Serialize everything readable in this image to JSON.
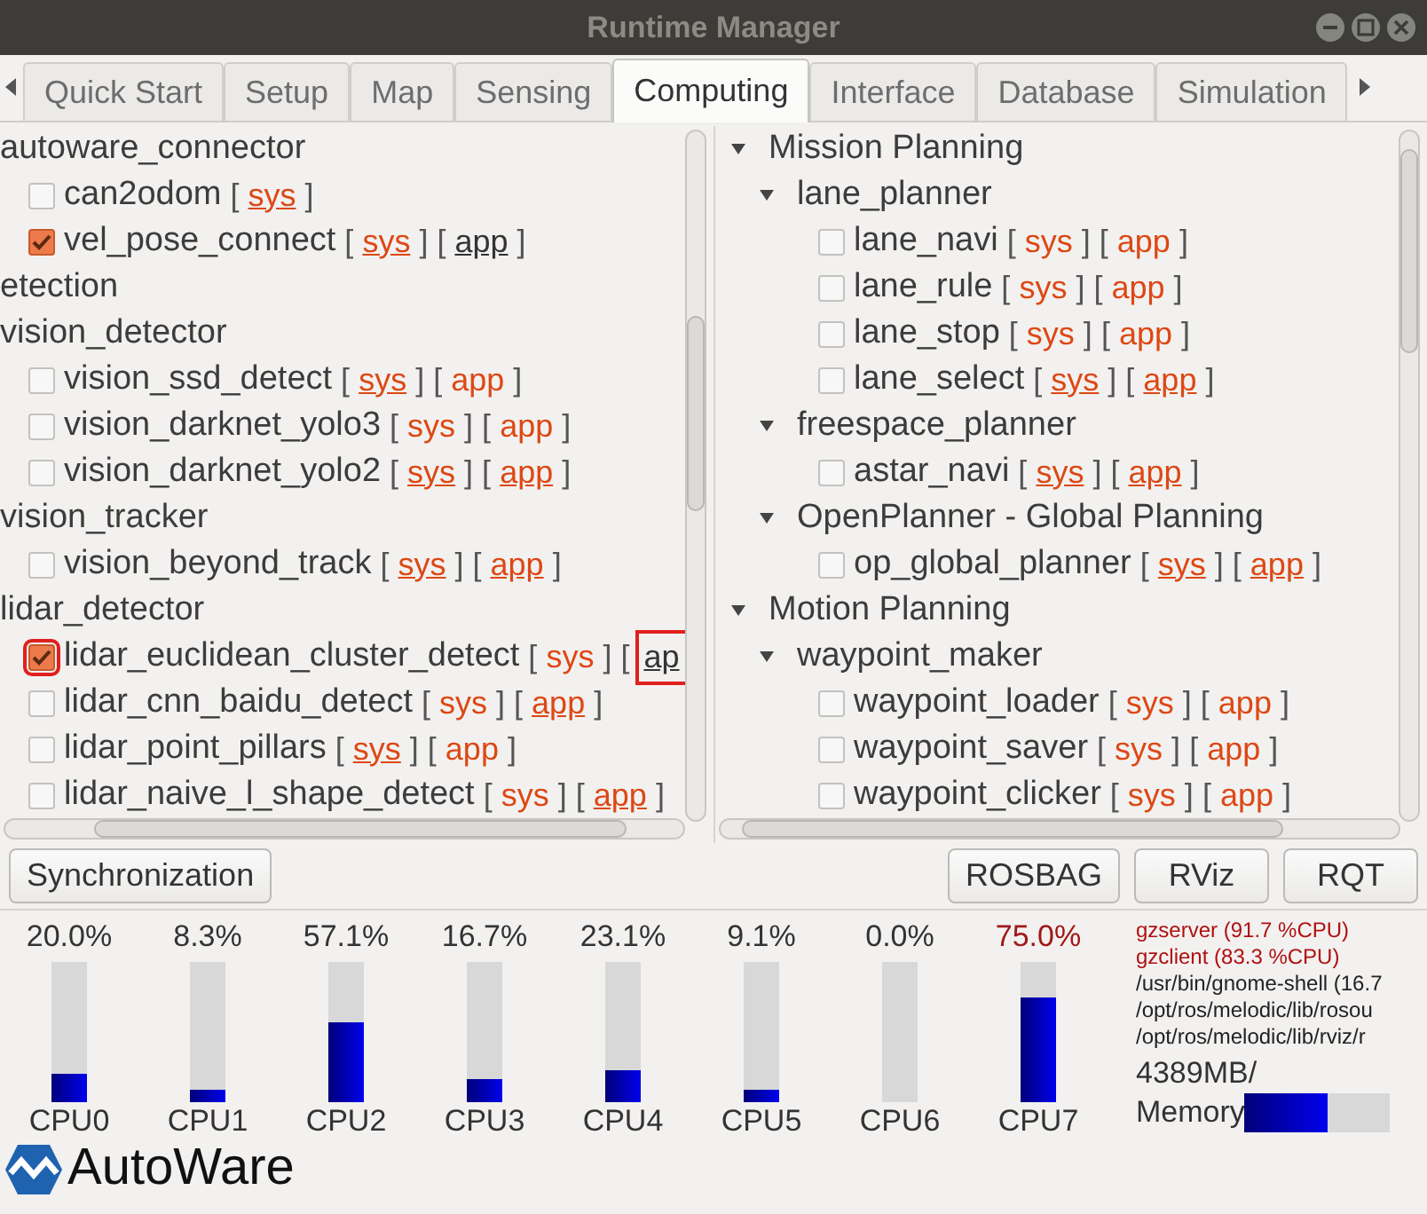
{
  "window": {
    "title": "Runtime Manager"
  },
  "tabs": [
    {
      "label": "Quick Start",
      "selected": false
    },
    {
      "label": "Setup",
      "selected": false
    },
    {
      "label": "Map",
      "selected": false
    },
    {
      "label": "Sensing",
      "selected": false
    },
    {
      "label": "Computing",
      "selected": true
    },
    {
      "label": "Interface",
      "selected": false
    },
    {
      "label": "Database",
      "selected": false
    },
    {
      "label": "Simulation",
      "selected": false
    }
  ],
  "left_tree": [
    {
      "kind": "group",
      "label": "autoware_connector",
      "children": [
        {
          "kind": "check",
          "label": "can2odom",
          "checked": false,
          "links": [
            {
              "label": "sys",
              "underlined": true,
              "visited": false
            }
          ]
        },
        {
          "kind": "check",
          "label": "vel_pose_connect",
          "checked": true,
          "links": [
            {
              "label": "sys",
              "underlined": true,
              "visited": false
            },
            {
              "label": "app",
              "underlined": true,
              "visited": true
            }
          ]
        }
      ]
    },
    {
      "kind": "group",
      "label": "etection"
    },
    {
      "kind": "group",
      "label": "vision_detector",
      "children": [
        {
          "kind": "check",
          "label": "vision_ssd_detect",
          "checked": false,
          "links": [
            {
              "label": "sys",
              "underlined": true,
              "visited": false
            },
            {
              "label": "app",
              "underlined": false,
              "visited": false
            }
          ]
        },
        {
          "kind": "check",
          "label": "vision_darknet_yolo3",
          "checked": false,
          "links": [
            {
              "label": "sys",
              "underlined": false,
              "visited": false
            },
            {
              "label": "app",
              "underlined": false,
              "visited": false
            }
          ]
        },
        {
          "kind": "check",
          "label": "vision_darknet_yolo2",
          "checked": false,
          "links": [
            {
              "label": "sys",
              "underlined": true,
              "visited": false
            },
            {
              "label": "app",
              "underlined": true,
              "visited": false
            }
          ]
        }
      ]
    },
    {
      "kind": "group",
      "label": "vision_tracker",
      "children": [
        {
          "kind": "check",
          "label": "vision_beyond_track",
          "checked": false,
          "links": [
            {
              "label": "sys",
              "underlined": true,
              "visited": false
            },
            {
              "label": "app",
              "underlined": true,
              "visited": false
            }
          ]
        }
      ]
    },
    {
      "kind": "group",
      "label": "lidar_detector",
      "children": [
        {
          "kind": "check",
          "label": "lidar_euclidean_cluster_detect",
          "checked": true,
          "annotated": true,
          "links": [
            {
              "label": "sys",
              "underlined": false,
              "visited": false
            },
            {
              "label": "ap",
              "underlined": true,
              "visited": true,
              "cut": true
            }
          ]
        },
        {
          "kind": "check",
          "label": "lidar_cnn_baidu_detect",
          "checked": false,
          "links": [
            {
              "label": "sys",
              "underlined": false,
              "visited": false
            },
            {
              "label": "app",
              "underlined": true,
              "visited": false
            }
          ]
        },
        {
          "kind": "check",
          "label": "lidar_point_pillars",
          "checked": false,
          "links": [
            {
              "label": "sys",
              "underlined": true,
              "visited": false
            },
            {
              "label": "app",
              "underlined": false,
              "visited": false
            }
          ]
        },
        {
          "kind": "check",
          "label": "lidar_naive_l_shape_detect",
          "checked": false,
          "links": [
            {
              "label": "sys",
              "underlined": false,
              "visited": false
            },
            {
              "label": "app",
              "underlined": true,
              "visited": false
            }
          ]
        }
      ]
    }
  ],
  "right_tree": [
    {
      "kind": "group",
      "label": "Mission Planning",
      "expanded": true,
      "children": [
        {
          "kind": "group",
          "label": "lane_planner",
          "expanded": true,
          "children": [
            {
              "kind": "check",
              "label": "lane_navi",
              "checked": false,
              "links": [
                {
                  "label": "sys",
                  "underlined": false,
                  "visited": false
                },
                {
                  "label": "app",
                  "underlined": false,
                  "visited": false
                }
              ]
            },
            {
              "kind": "check",
              "label": "lane_rule",
              "checked": false,
              "links": [
                {
                  "label": "sys",
                  "underlined": false,
                  "visited": false
                },
                {
                  "label": "app",
                  "underlined": false,
                  "visited": false
                }
              ]
            },
            {
              "kind": "check",
              "label": "lane_stop",
              "checked": false,
              "links": [
                {
                  "label": "sys",
                  "underlined": false,
                  "visited": false
                },
                {
                  "label": "app",
                  "underlined": false,
                  "visited": false
                }
              ]
            },
            {
              "kind": "check",
              "label": "lane_select",
              "checked": false,
              "links": [
                {
                  "label": "sys",
                  "underlined": true,
                  "visited": false
                },
                {
                  "label": "app",
                  "underlined": true,
                  "visited": false
                }
              ]
            }
          ]
        },
        {
          "kind": "group",
          "label": "freespace_planner",
          "expanded": true,
          "children": [
            {
              "kind": "check",
              "label": "astar_navi",
              "checked": false,
              "links": [
                {
                  "label": "sys",
                  "underlined": true,
                  "visited": false
                },
                {
                  "label": "app",
                  "underlined": true,
                  "visited": false
                }
              ]
            }
          ]
        },
        {
          "kind": "group",
          "label": "OpenPlanner - Global Planning",
          "expanded": true,
          "children": [
            {
              "kind": "check",
              "label": "op_global_planner",
              "checked": false,
              "links": [
                {
                  "label": "sys",
                  "underlined": true,
                  "visited": false
                },
                {
                  "label": "app",
                  "underlined": true,
                  "visited": false
                }
              ]
            }
          ]
        }
      ]
    },
    {
      "kind": "group",
      "label": "Motion Planning",
      "expanded": true,
      "children": [
        {
          "kind": "group",
          "label": "waypoint_maker",
          "expanded": true,
          "children": [
            {
              "kind": "check",
              "label": "waypoint_loader",
              "checked": false,
              "links": [
                {
                  "label": "sys",
                  "underlined": false,
                  "visited": false
                },
                {
                  "label": "app",
                  "underlined": false,
                  "visited": false
                }
              ]
            },
            {
              "kind": "check",
              "label": "waypoint_saver",
              "checked": false,
              "links": [
                {
                  "label": "sys",
                  "underlined": false,
                  "visited": false
                },
                {
                  "label": "app",
                  "underlined": false,
                  "visited": false
                }
              ]
            },
            {
              "kind": "check",
              "label": "waypoint_clicker",
              "checked": false,
              "links": [
                {
                  "label": "sys",
                  "underlined": false,
                  "visited": false
                },
                {
                  "label": "app",
                  "underlined": false,
                  "visited": false
                }
              ]
            }
          ]
        }
      ]
    }
  ],
  "buttons_left": [
    "Synchronization"
  ],
  "buttons_right": [
    "ROSBAG",
    "RViz",
    "RQT"
  ],
  "cpus": [
    {
      "name": "CPU0",
      "reading": "20.0%",
      "level": 0.2,
      "alert": false
    },
    {
      "name": "CPU1",
      "reading": "8.3%",
      "level": 0.083,
      "alert": false
    },
    {
      "name": "CPU2",
      "reading": "57.1%",
      "level": 0.571,
      "alert": false
    },
    {
      "name": "CPU3",
      "reading": "16.7%",
      "level": 0.167,
      "alert": false
    },
    {
      "name": "CPU4",
      "reading": "23.1%",
      "level": 0.231,
      "alert": false
    },
    {
      "name": "CPU5",
      "reading": "9.1%",
      "level": 0.091,
      "alert": false
    },
    {
      "name": "CPU6",
      "reading": "0.0%",
      "level": 0,
      "alert": false
    },
    {
      "name": "CPU7",
      "reading": "75.0%",
      "level": 0.75,
      "alert": true
    }
  ],
  "processes": [
    {
      "text": "gzserver (91.7 %CPU)",
      "alert": true
    },
    {
      "text": "gzclient (83.3 %CPU)",
      "alert": true
    },
    {
      "text": "/usr/bin/gnome-shell (16.7",
      "alert": false
    },
    {
      "text": "/opt/ros/melodic/lib/rosou",
      "alert": false
    },
    {
      "text": "/opt/ros/melodic/lib/rviz/r",
      "alert": false
    }
  ],
  "memory": {
    "reading": "4389MB/",
    "label": "Memory",
    "level": 0.57
  },
  "brackets": {
    "open": "[",
    "close": "]"
  },
  "logo": {
    "text": "AutoWare"
  }
}
